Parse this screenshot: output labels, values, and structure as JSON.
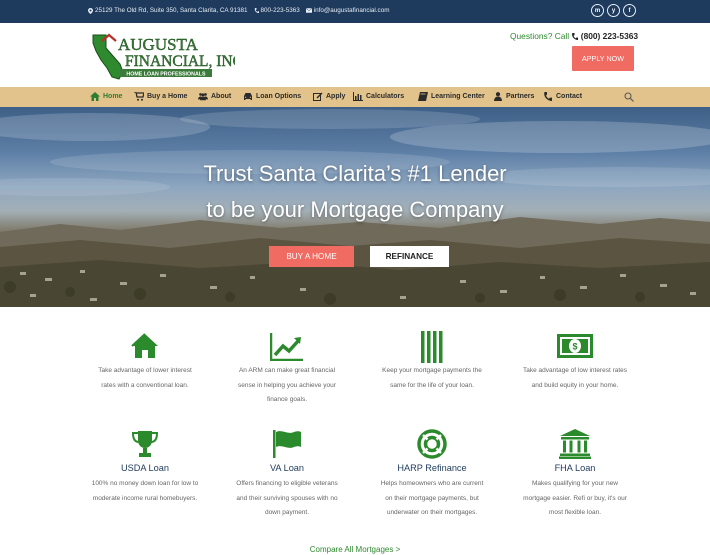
{
  "colors": {
    "topbar": "#1e3a5c",
    "accent_green": "#2e8a2e",
    "cta_coral": "#f06b62",
    "nav_tan": "#e2c38c"
  },
  "topbar": {
    "address": "25129 The Old Rd, Suite 350, Santa Clarita, CA 91381",
    "phone": "800-223-5363",
    "email": "info@augustafinancial.com",
    "social": [
      "m",
      "y",
      "f"
    ]
  },
  "header": {
    "logo_line1": "AUGUSTA",
    "logo_line2": "FINANCIAL, INC",
    "logo_line3": "HOME LOAN PROFESSIONALS",
    "questions_prefix": "Questions? Call",
    "questions_phone": "(800) 223-5363",
    "apply_label": "APPLY NOW"
  },
  "nav": {
    "items": [
      {
        "label": "Home",
        "icon": "home-icon"
      },
      {
        "label": "Buy a Home",
        "icon": "cart-icon"
      },
      {
        "label": "About",
        "icon": "people-icon"
      },
      {
        "label": "Loan Options",
        "icon": "car-icon"
      },
      {
        "label": "Apply",
        "icon": "edit-icon"
      },
      {
        "label": "Calculators",
        "icon": "chart-icon"
      },
      {
        "label": "Learning Center",
        "icon": "book-icon"
      },
      {
        "label": "Partners",
        "icon": "person-icon"
      },
      {
        "label": "Contact",
        "icon": "phone-icon"
      }
    ],
    "search_icon": "search-icon"
  },
  "hero": {
    "headline_line1": "Trust Santa Clarita’s #1 Lender",
    "headline_line2": "to be your Mortgage Company",
    "buy_label": "BUY A HOME",
    "refinance_label": "REFINANCE"
  },
  "features": [
    {
      "title": "",
      "icon": "house-icon",
      "desc": [
        "Take advantage of lower interest",
        "rates with a conventional loan."
      ]
    },
    {
      "title": "",
      "icon": "trend-icon",
      "desc": [
        "An ARM can make great financial",
        "sense in helping you achieve your",
        "finance goals."
      ]
    },
    {
      "title": "",
      "icon": "bars-icon",
      "desc": [
        "Keep your mortgage payments the",
        "same for the life of your loan."
      ]
    },
    {
      "title": "",
      "icon": "money-icon",
      "desc": [
        "Take advantage of low interest rates",
        "and build equity in your home."
      ]
    },
    {
      "title": "USDA Loan",
      "icon": "trophy-icon",
      "desc": [
        "100% no money down loan for low to",
        "moderate income rural homebuyers."
      ]
    },
    {
      "title": "VA Loan",
      "icon": "flag-icon",
      "desc": [
        "Offers financing to eligible veterans",
        "and their surviving spouses with no",
        "down payment."
      ]
    },
    {
      "title": "HARP Refinance",
      "icon": "lifering-icon",
      "desc": [
        "Helps homeowners who are current",
        "on their mortgage payments, but",
        "underwater on their mortgages."
      ]
    },
    {
      "title": "FHA Loan",
      "icon": "bank-icon",
      "desc": [
        "Makes qualifying for your new",
        "mortgage easier. Refi or buy, it's our",
        "most flexible loan."
      ]
    }
  ],
  "compare_label": "Compare All Mortgages >"
}
